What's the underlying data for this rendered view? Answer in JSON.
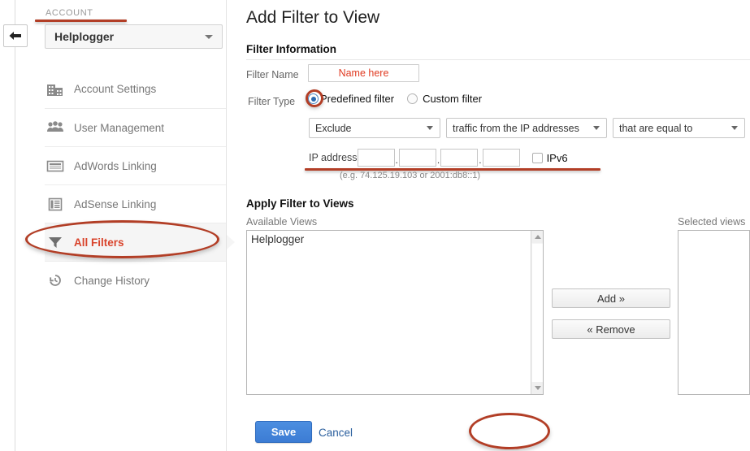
{
  "sidebar": {
    "back_icon": "back-arrow-icon",
    "account_label": "ACCOUNT",
    "account_value": "Helplogger",
    "items": [
      {
        "label": "Account Settings",
        "icon": "building-icon",
        "active": false
      },
      {
        "label": "User Management",
        "icon": "people-icon",
        "active": false
      },
      {
        "label": "AdWords Linking",
        "icon": "card-icon",
        "active": false
      },
      {
        "label": "AdSense Linking",
        "icon": "list-icon",
        "active": false
      },
      {
        "label": "All Filters",
        "icon": "funnel-icon",
        "active": true
      },
      {
        "label": "Change History",
        "icon": "history-clock-icon",
        "active": false
      }
    ]
  },
  "main": {
    "page_title": "Add Filter to View",
    "sections": {
      "filter_information": "Filter Information",
      "apply_filter_to_views": "Apply Filter to Views"
    },
    "filter_name": {
      "label": "Filter Name",
      "value": "Name here",
      "placeholder": "Name here"
    },
    "filter_type": {
      "label": "Filter Type",
      "options": [
        {
          "label": "Predefined filter",
          "selected": true
        },
        {
          "label": "Custom filter",
          "selected": false
        }
      ]
    },
    "predefined": {
      "action": "Exclude",
      "subject": "traffic from the IP addresses",
      "condition": "that are equal to"
    },
    "ip": {
      "label": "IP address",
      "octet1": "",
      "octet2": "",
      "octet3": "",
      "octet4": "",
      "separator": ".",
      "ipv6_label": "IPv6",
      "ipv6_checked": false,
      "hint": "(e.g. 74.125.19.103 or 2001:db8::1)"
    },
    "views": {
      "available_label": "Available Views",
      "selected_label": "Selected views",
      "available_items": [
        "Helplogger"
      ],
      "selected_items": [],
      "add_button": "Add »",
      "remove_button": "« Remove"
    },
    "actions": {
      "save": "Save",
      "cancel": "Cancel"
    }
  },
  "annotations": {
    "accent_color": "#b23e26",
    "highlight_text_color": "#d9442c",
    "name_text_color": "#e03b22",
    "link_color": "#2b5f9e",
    "save_button_color": "#3c7cd4"
  }
}
